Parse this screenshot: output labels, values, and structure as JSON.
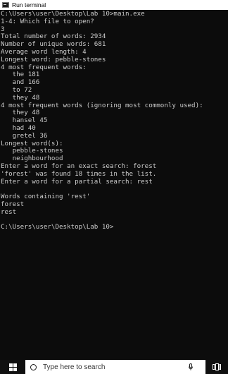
{
  "window": {
    "title": "Run terminal",
    "icon": "console-app-icon"
  },
  "console": {
    "lines": [
      "C:\\Users\\user\\Desktop\\Lab 10>main.exe",
      "1-4: Which file to open?",
      "3",
      "Total number of words: 2934",
      "Number of unique words: 681",
      "Average word length: 4",
      "Longest word: pebble-stones",
      "4 most frequent words:",
      "   the 181",
      "   and 166",
      "   to 72",
      "   they 48",
      "4 most frequent words (ignoring most commonly used):",
      "   they 48",
      "   hansel 45",
      "   had 40",
      "   gretel 36",
      "Longest word(s):",
      "   pebble-stones",
      "   neighbourhood",
      "Enter a word for an exact search: forest",
      "'forest' was found 18 times in the list.",
      "Enter a word for a partial search: rest",
      "",
      "Words containing 'rest'",
      "forest",
      "rest",
      "",
      "C:\\Users\\user\\Desktop\\Lab 10>"
    ]
  },
  "taskbar": {
    "start_icon": "windows-logo-icon",
    "search_placeholder": "Type here to search",
    "search_icon": "cortana-circle-icon",
    "mic_icon": "microphone-icon",
    "task_view_icon": "task-view-icon"
  },
  "colors": {
    "console_background": "#0c0c0c",
    "console_text": "#cccccc",
    "taskbar_background": "#101010",
    "titlebar_background": "#ffffff"
  }
}
